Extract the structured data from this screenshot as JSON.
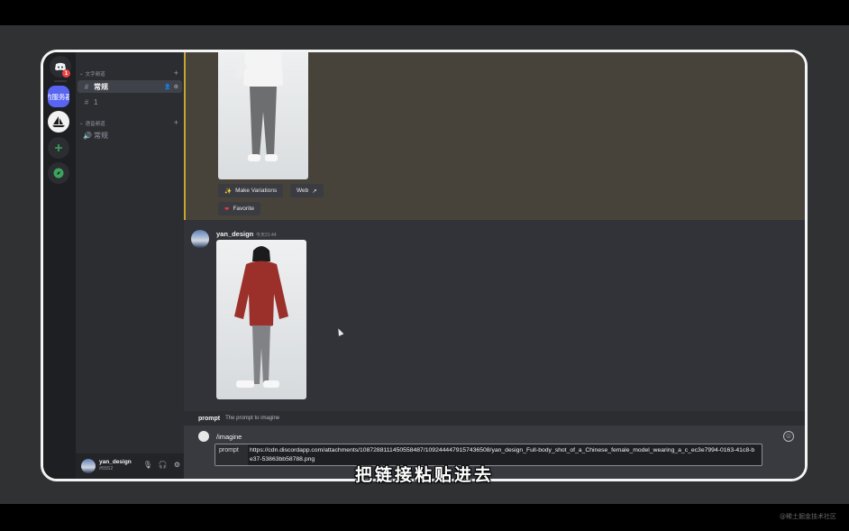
{
  "rail": {
    "notification_count": "1",
    "server_label": "的服务器"
  },
  "sidebar": {
    "text_category": "文字频道",
    "voice_category": "语音频道",
    "text_channels": [
      {
        "name": "常规",
        "active": true
      },
      {
        "name": "1",
        "active": false
      }
    ],
    "voice_channels": [
      {
        "name": "常规"
      }
    ]
  },
  "user_panel": {
    "username": "yan_design",
    "tag": "#5552"
  },
  "messages": {
    "buttons": {
      "make_variations": "Make Variations",
      "web": "Web",
      "favorite": "Favorite"
    },
    "latest": {
      "author": "yan_design",
      "timestamp": "今天21:44"
    }
  },
  "command_hint": {
    "name": "prompt",
    "description": "The prompt to imagine"
  },
  "composer": {
    "command": "/imagine",
    "param_label": "prompt",
    "param_value": "https://cdn.discordapp.com/attachments/1087288111450558487/1092444479157436508/yan_design_Full-body_shot_of_a_Chinese_female_model_wearing_a_c_ec3e7994-0163-41c8-be37-53863bb58788.png"
  },
  "subtitle": "把链接粘贴进去",
  "watermark": "@稀土掘金技术社区",
  "colors": {
    "accent": "#5865f2",
    "highlight_bar": "#c7a531",
    "favorite_heart": "#e03a45",
    "jacket": "#9b2f2a"
  },
  "icons": [
    "discord-logo-icon",
    "explore-compass-icon",
    "mic-icon",
    "headphones-icon",
    "settings-gear-icon",
    "sparkle-icon",
    "external-link-icon",
    "heart-icon",
    "emoji-icon"
  ]
}
